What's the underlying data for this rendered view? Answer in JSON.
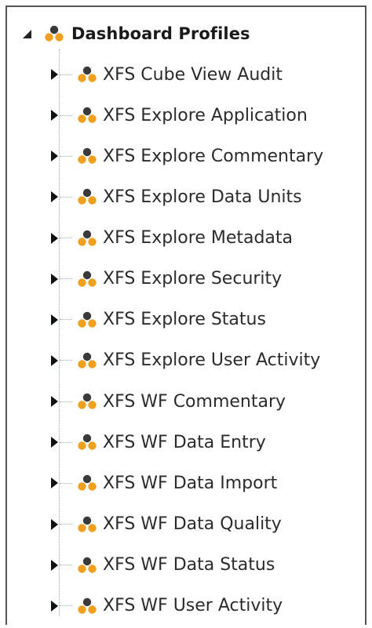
{
  "tree": {
    "root": {
      "label": "Dashboard Profiles",
      "expanded": true,
      "icon": "dashboard-profile-icon"
    },
    "children": [
      {
        "label": "XFS Cube View Audit",
        "icon": "dashboard-profile-icon",
        "expanded": false
      },
      {
        "label": "XFS Explore Application",
        "icon": "dashboard-profile-icon",
        "expanded": false
      },
      {
        "label": "XFS Explore Commentary",
        "icon": "dashboard-profile-icon",
        "expanded": false
      },
      {
        "label": "XFS Explore Data Units",
        "icon": "dashboard-profile-icon",
        "expanded": false
      },
      {
        "label": "XFS Explore Metadata",
        "icon": "dashboard-profile-icon",
        "expanded": false
      },
      {
        "label": "XFS Explore Security",
        "icon": "dashboard-profile-icon",
        "expanded": false
      },
      {
        "label": "XFS Explore Status",
        "icon": "dashboard-profile-icon",
        "expanded": false
      },
      {
        "label": "XFS Explore User Activity",
        "icon": "dashboard-profile-icon",
        "expanded": false
      },
      {
        "label": "XFS WF Commentary",
        "icon": "dashboard-profile-icon",
        "expanded": false
      },
      {
        "label": "XFS WF Data Entry",
        "icon": "dashboard-profile-icon",
        "expanded": false
      },
      {
        "label": "XFS WF Data Import",
        "icon": "dashboard-profile-icon",
        "expanded": false
      },
      {
        "label": "XFS WF Data Quality",
        "icon": "dashboard-profile-icon",
        "expanded": false
      },
      {
        "label": "XFS WF Data Status",
        "icon": "dashboard-profile-icon",
        "expanded": false
      },
      {
        "label": "XFS WF User Activity",
        "icon": "dashboard-profile-icon",
        "expanded": false
      }
    ]
  },
  "colors": {
    "icon_dark": "#3a3a3a",
    "icon_orange": "#f0a020",
    "tree_line": "#9aa9c4",
    "text": "#2b2b2b"
  }
}
